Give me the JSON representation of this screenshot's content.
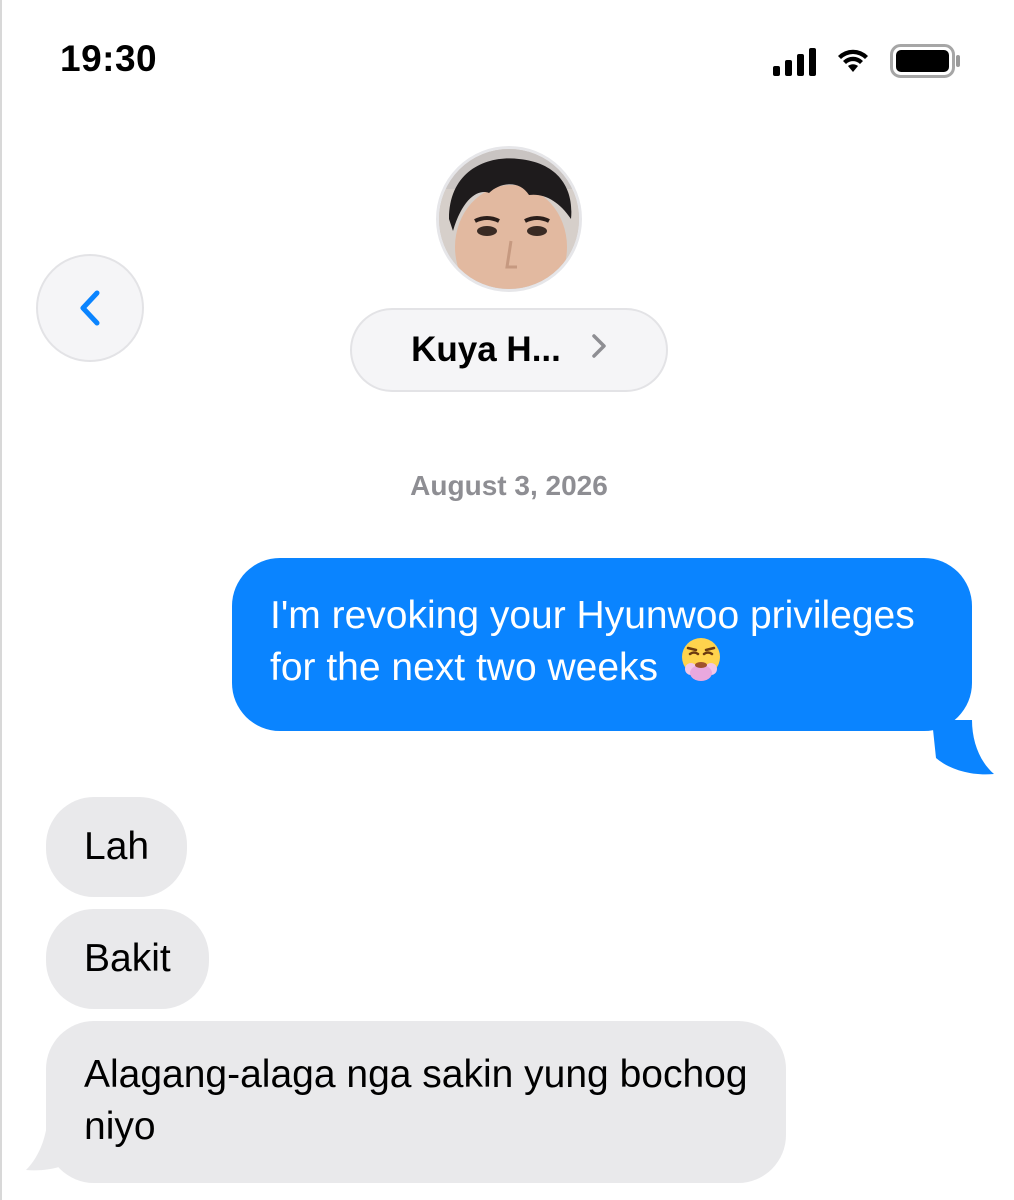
{
  "status_bar": {
    "time": "19:30",
    "icons": [
      "signal-icon",
      "wifi-icon",
      "battery-icon"
    ]
  },
  "header": {
    "back_icon": "chevron-left-icon",
    "contact_name": "Kuya H...",
    "detail_icon": "chevron-right-icon"
  },
  "conversation": {
    "date": "August 3, 2026",
    "messages": [
      {
        "direction": "outgoing",
        "text": "I'm revoking your Hyunwoo privileges for the next two weeks",
        "emoji": "face-with-steam-hugging-icon"
      },
      {
        "direction": "incoming",
        "text": "Lah"
      },
      {
        "direction": "incoming",
        "text": "Bakit"
      },
      {
        "direction": "incoming",
        "text": "Alagang-alaga nga sakin yung bochog niyo"
      }
    ]
  },
  "colors": {
    "outgoing_bubble": "#0a84ff",
    "incoming_bubble": "#e9e9eb",
    "accent": "#0a84ff",
    "secondary_text": "#8e8e93"
  }
}
